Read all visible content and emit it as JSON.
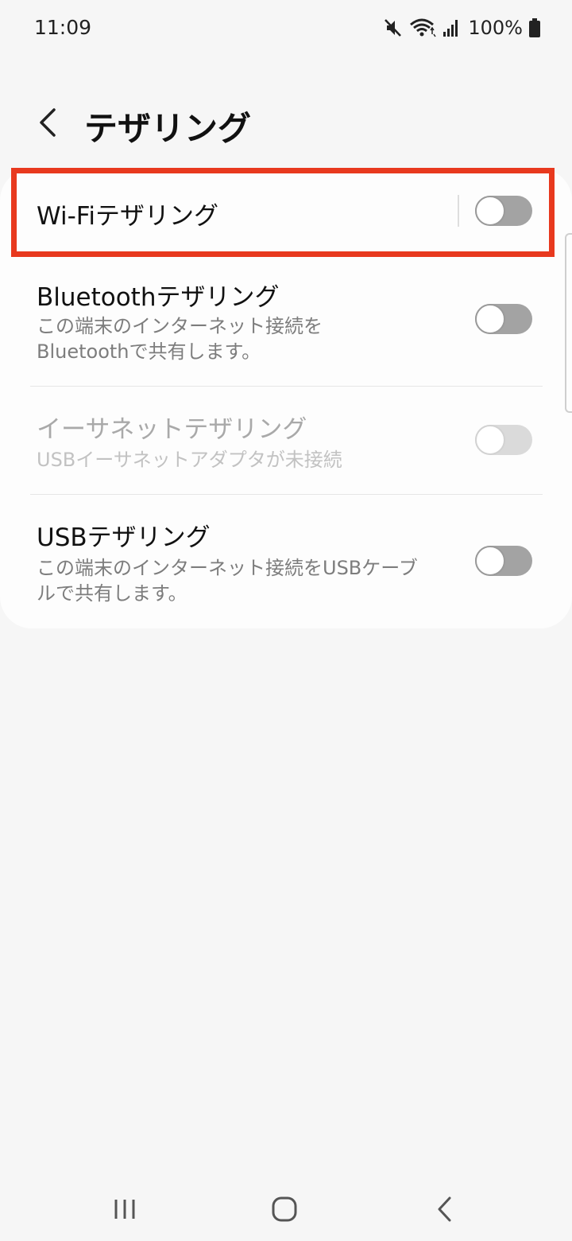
{
  "status_bar": {
    "time": "11:09",
    "battery": "100%",
    "icons": [
      "mute-icon",
      "wifi-icon",
      "signal-icon",
      "battery-icon"
    ]
  },
  "header": {
    "title": "テザリング",
    "back_icon": "chevron-left-icon"
  },
  "items": [
    {
      "title": "Wi-Fiテザリング",
      "subtitle_1": "",
      "subtitle_2": "",
      "enabled": true,
      "on": false
    },
    {
      "title": "Bluetoothテザリング",
      "subtitle_1": "この端末のインターネット接続を",
      "subtitle_2": "Bluetoothで共有します。",
      "enabled": true,
      "on": false
    },
    {
      "title": "イーサネットテザリング",
      "subtitle_1": "USBイーサネットアダプタが未接続",
      "subtitle_2": "",
      "enabled": false,
      "on": false
    },
    {
      "title": "USBテザリング",
      "subtitle_1": "この端末のインターネット接続をUSBケーブ",
      "subtitle_2": "ルで共有します。",
      "enabled": true,
      "on": false
    }
  ],
  "colors": {
    "highlight": "#e8391e",
    "background": "#f6f6f6",
    "card": "#fdfdfd",
    "toggle_off": "#a3a3a3"
  },
  "nav_bar": {
    "icons": [
      "recent-apps-icon",
      "home-icon",
      "back-icon"
    ]
  }
}
